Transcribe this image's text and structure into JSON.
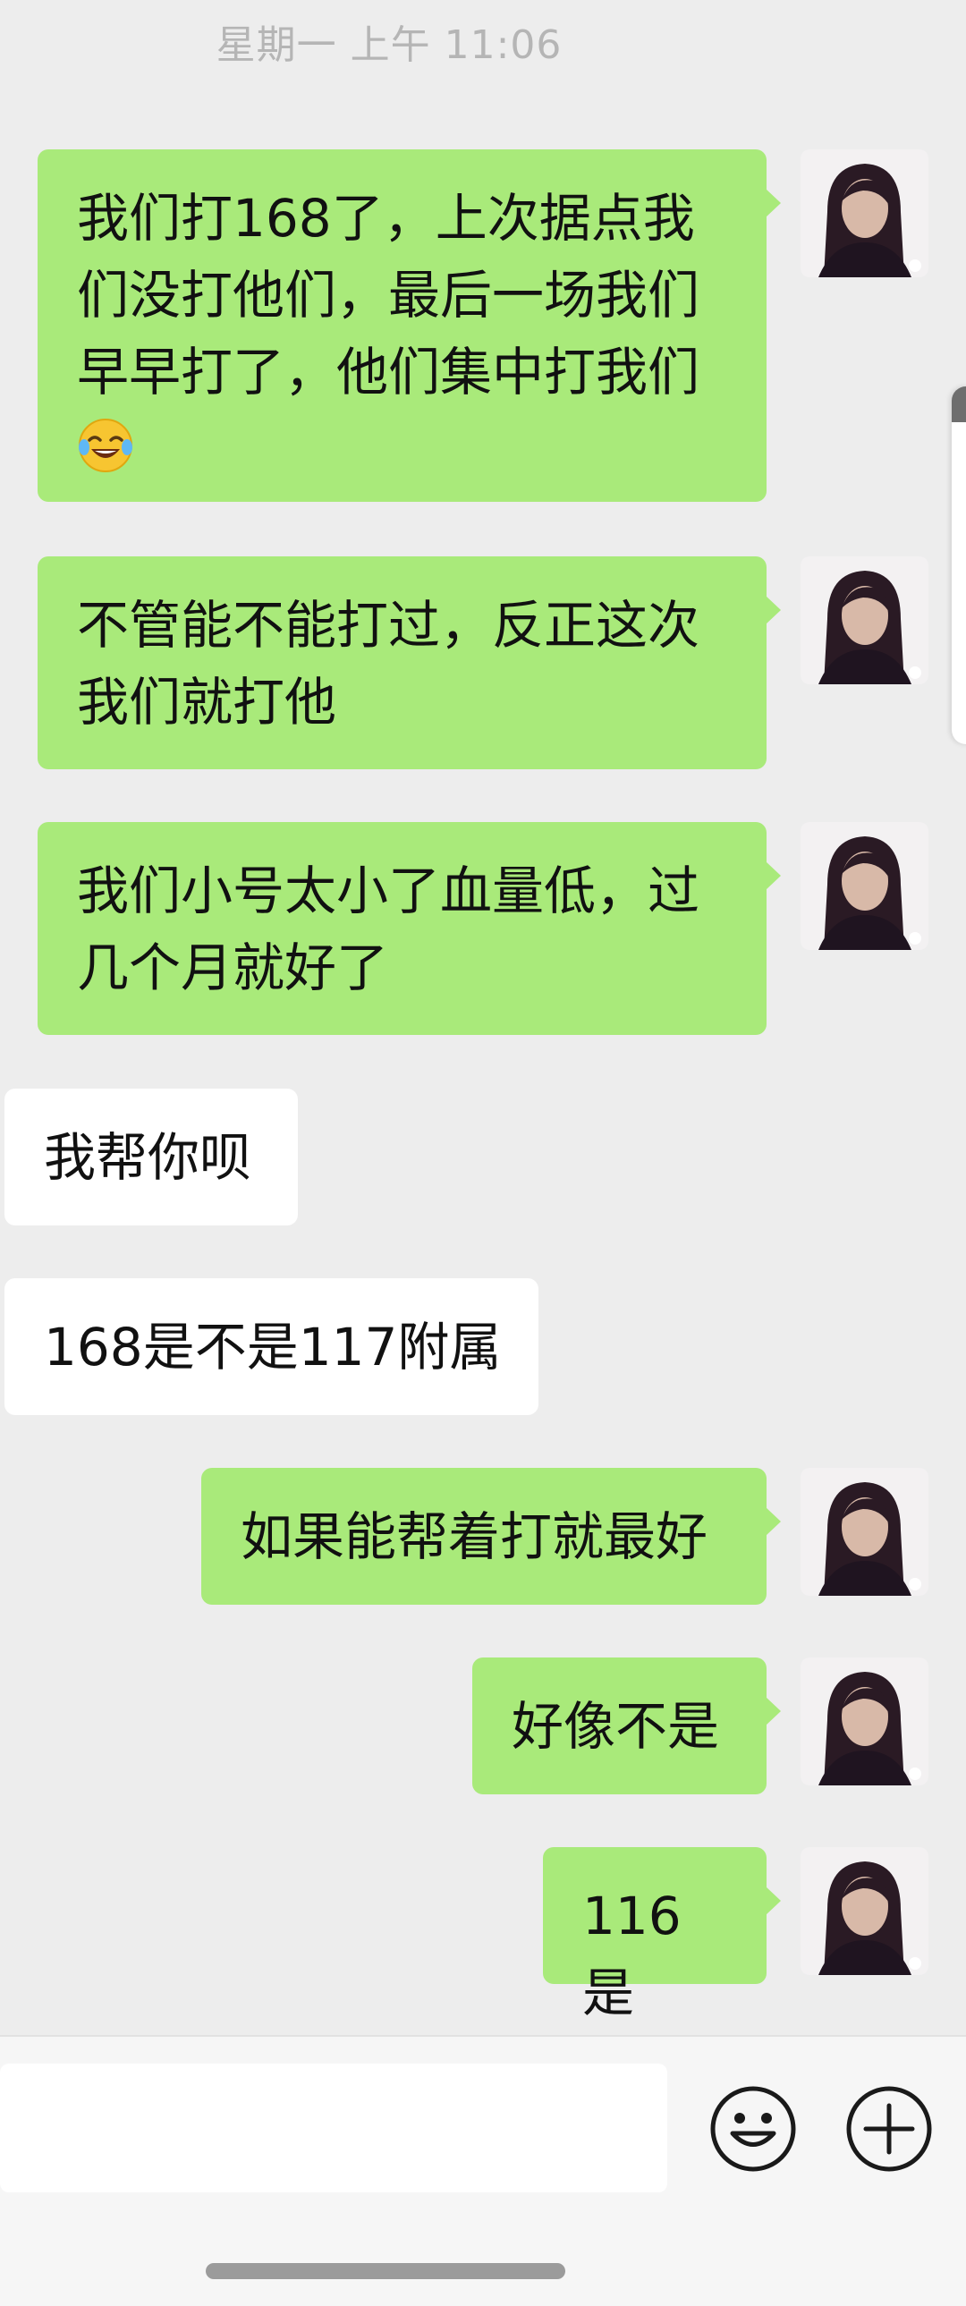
{
  "header": {
    "timestamp": "星期一 上午 11:06"
  },
  "messages": [
    {
      "side": "sent",
      "lines": [
        "我们打168了，上次据点我",
        "们没打他们，最后一场我们",
        "早早打了，他们集中打我们"
      ],
      "emoji": "tears-of-joy-emoji"
    },
    {
      "side": "sent",
      "lines": [
        "不管能不能打过，反正这次",
        "我们就打他"
      ]
    },
    {
      "side": "sent",
      "lines": [
        "我们小号太小了血量低，过",
        "几个月就好了"
      ]
    },
    {
      "side": "received",
      "text": "我帮你呗"
    },
    {
      "side": "received",
      "text": "168是不是117附属"
    },
    {
      "side": "sent",
      "text": "如果能帮着打就最好"
    },
    {
      "side": "sent",
      "text": "好像不是"
    },
    {
      "side": "sent",
      "text": "116是"
    }
  ],
  "input": {
    "value": "",
    "placeholder": ""
  },
  "icons": {
    "emoji_button": "smiley-face-icon",
    "more_button": "plus-circle-icon"
  },
  "colors": {
    "sent_bubble": "#A9EA7A",
    "received_bubble": "#FFFFFF",
    "background": "#EDEDED"
  }
}
